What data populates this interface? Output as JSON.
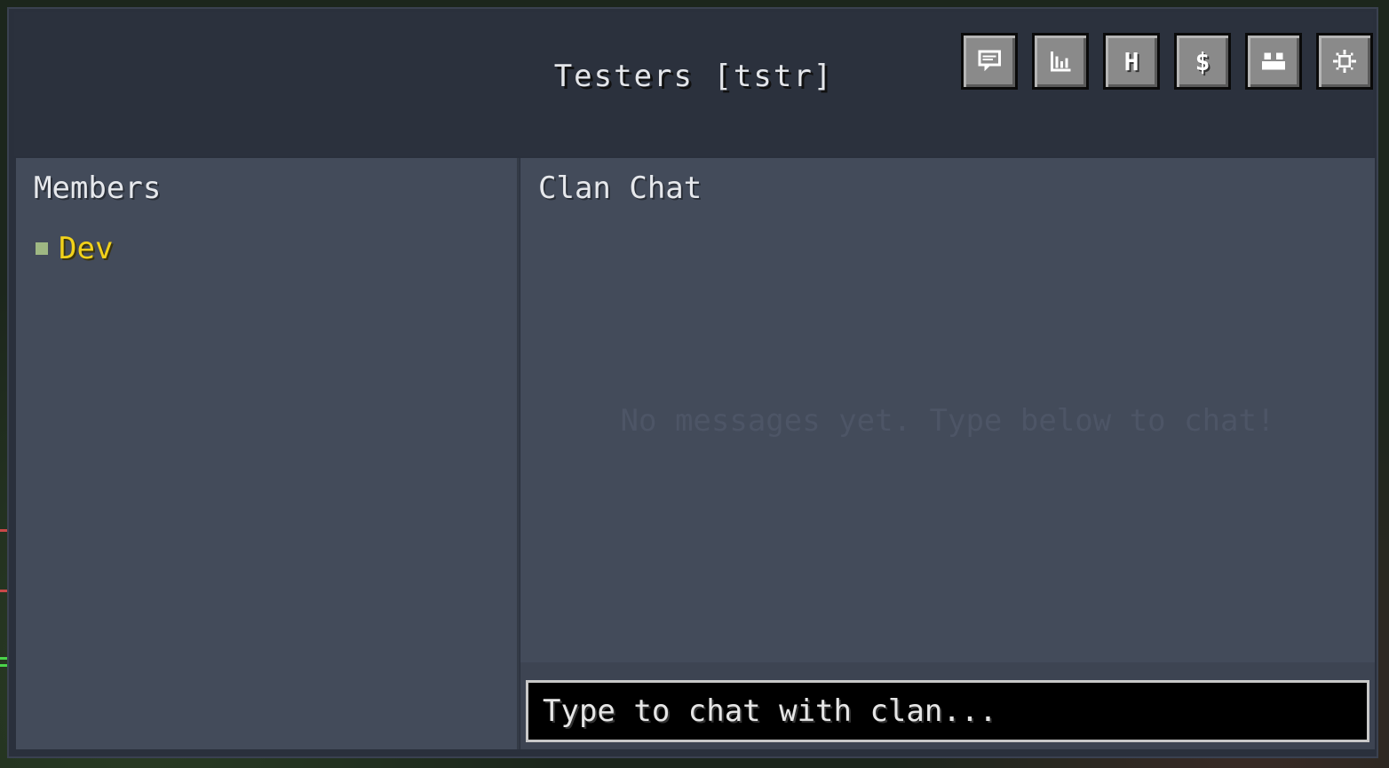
{
  "window": {
    "title": "Testers [tstr]"
  },
  "toolbar": {
    "buttons": [
      {
        "name": "chat-button",
        "icon": "chat-bubble-icon"
      },
      {
        "name": "stats-button",
        "icon": "bar-chart-icon"
      },
      {
        "name": "home-button",
        "icon": "letter-h-icon",
        "glyph": "H"
      },
      {
        "name": "bank-button",
        "icon": "dollar-icon",
        "glyph": "$"
      },
      {
        "name": "members-button",
        "icon": "people-icon"
      },
      {
        "name": "settings-button",
        "icon": "gear-icon"
      }
    ]
  },
  "members": {
    "title": "Members",
    "list": [
      {
        "name": "Dev",
        "color": "#f2d21a",
        "status_color": "#9fb883"
      }
    ]
  },
  "chat": {
    "title": "Clan Chat",
    "empty_message": "No messages yet. Type below to chat!",
    "input_placeholder": "Type to chat with clan..."
  }
}
